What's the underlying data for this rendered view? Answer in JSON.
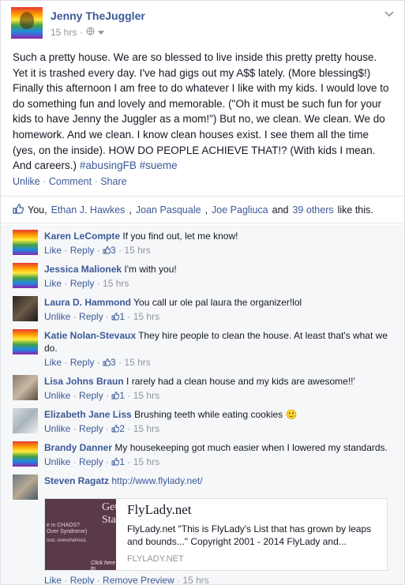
{
  "post": {
    "author": "Jenny TheJuggler",
    "time": "15 hrs",
    "body": "Such a pretty house. We are so blessed to live inside this pretty pretty house. Yet it is trashed every day. I've had gigs out my A$$ lately. (More blessing$!) Finally this afternoon I am free to do whatever I like with my kids. I would love to do something fun and lovely and memorable. (\"Oh it must be such fun for your kids to have Jenny the Juggler as a mom!\") But no, we clean. We clean. We do homework. And we clean. I know clean houses exist. I see them all the time (yes, on the inside). HOW DO PEOPLE ACHIEVE THAT!? (With kids I mean. And careers.)",
    "tags": [
      "#abusingFB",
      "#sueme"
    ],
    "actions": {
      "unlike": "Unlike",
      "comment": "Comment",
      "share": "Share",
      "dot": "·"
    }
  },
  "likes": {
    "you": "You,",
    "people": [
      "Ethan J. Hawkes",
      "Joan Pasquale",
      "Joe Pagliuca"
    ],
    "sep1": ",",
    "and": "and",
    "others": "39 others",
    "suffix": "like this."
  },
  "comments": [
    {
      "name": "Karen LeCompte",
      "text": "If you find out, let me know!",
      "action": "Like",
      "reply": "Reply",
      "count": "3",
      "time": "15 hrs",
      "avatar": "rainbow"
    },
    {
      "name": "Jessica Malionek",
      "text": "I'm with you!",
      "action": "Like",
      "reply": "Reply",
      "count": "",
      "time": "15 hrs",
      "avatar": "rainbow"
    },
    {
      "name": "Laura D. Hammond",
      "text": "You call ur ole pal laura the organizer!lol",
      "action": "Unlike",
      "reply": "Reply",
      "count": "1",
      "time": "15 hrs",
      "avatar": "dark"
    },
    {
      "name": "Katie Nolan-Stevaux",
      "text": "They hire people to clean the house. At least that's what we do.",
      "action": "Like",
      "reply": "Reply",
      "count": "3",
      "time": "15 hrs",
      "avatar": "rainbow"
    },
    {
      "name": "Lisa Johns Braun",
      "text": "I rarely had a clean house and my kids are awesome!!'",
      "action": "Unlike",
      "reply": "Reply",
      "count": "1",
      "time": "15 hrs",
      "avatar": "photo"
    },
    {
      "name": "Elizabeth Jane Liss",
      "text": "Brushing teeth while eating cookies",
      "emoji": "🙂",
      "action": "Unlike",
      "reply": "Reply",
      "count": "2",
      "time": "15 hrs",
      "avatar": "light"
    },
    {
      "name": "Brandy Danner",
      "text": "My housekeeping got much easier when I lowered my standards.",
      "action": "Unlike",
      "reply": "Reply",
      "count": "1",
      "time": "15 hrs",
      "avatar": "rainbow"
    },
    {
      "name": "Steven Ragatz",
      "text": "http://www.flylady.net/",
      "action": "Like",
      "reply": "Reply",
      "remove": "Remove Preview",
      "time": "15 hrs",
      "avatar": "group"
    }
  ],
  "preview": {
    "title": "FlyLady.net",
    "desc": "FlyLady.net \"This is FlyLady's List that has grown by leaps and bounds...\" Copyright 2001 - 2014 FlyLady and...",
    "domain": "FLYLADY.NET",
    "img_line1": "Get",
    "img_line2": "Star",
    "img_text1": "e in CHAOS?",
    "img_text2": "Over Syndrome)",
    "img_text3": "ood, overwhelmed,",
    "img_text4": "Click here to"
  },
  "colors": {
    "link": "#3b5998",
    "meta": "#90949c",
    "text": "#141823",
    "comment_bg": "#f6f7f9"
  }
}
